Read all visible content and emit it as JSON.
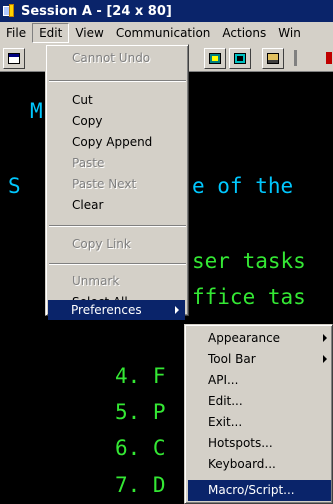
{
  "window": {
    "title": "Session A - [24 x 80]"
  },
  "menubar": [
    "File",
    "Edit",
    "View",
    "Communication",
    "Actions",
    "Win"
  ],
  "edit_menu": {
    "items": [
      {
        "label": "Cannot Undo",
        "disabled": true
      },
      {
        "label": "Cut",
        "disabled": false
      },
      {
        "label": "Copy",
        "disabled": false
      },
      {
        "label": "Copy Append",
        "disabled": false
      },
      {
        "label": "Paste",
        "disabled": true
      },
      {
        "label": "Paste Next",
        "disabled": true
      },
      {
        "label": "Clear",
        "disabled": false
      },
      {
        "label": "Copy Link",
        "disabled": true
      },
      {
        "label": "Unmark",
        "disabled": true
      },
      {
        "label": "Select All",
        "disabled": false
      },
      {
        "label": "Preferences",
        "disabled": false,
        "highlighted": true,
        "submenu": true
      }
    ]
  },
  "preferences_menu": {
    "items": [
      {
        "label": "Appearance",
        "submenu": true
      },
      {
        "label": "Tool Bar",
        "submenu": true
      },
      {
        "label": "API..."
      },
      {
        "label": "Edit..."
      },
      {
        "label": "Exit..."
      },
      {
        "label": "Hotspots..."
      },
      {
        "label": "Keyboard..."
      },
      {
        "label": "Macro/Script...",
        "highlighted": true
      }
    ]
  },
  "terminal": {
    "lines": [
      {
        "text": "M"
      },
      {
        "text": "S"
      },
      {
        "text": "e of the"
      },
      {
        "text": "ser tasks"
      },
      {
        "text": "ffice tas"
      },
      {
        "text": "4. F"
      },
      {
        "text": "5. P"
      },
      {
        "text": "6. C"
      },
      {
        "text": "7. D"
      }
    ]
  },
  "colors": {
    "titlebar": "#0a246a",
    "menu_bg": "#d4d0c8",
    "highlight": "#0a246a",
    "terminal_cyan": "#00c8ff",
    "terminal_green": "#34e834"
  }
}
